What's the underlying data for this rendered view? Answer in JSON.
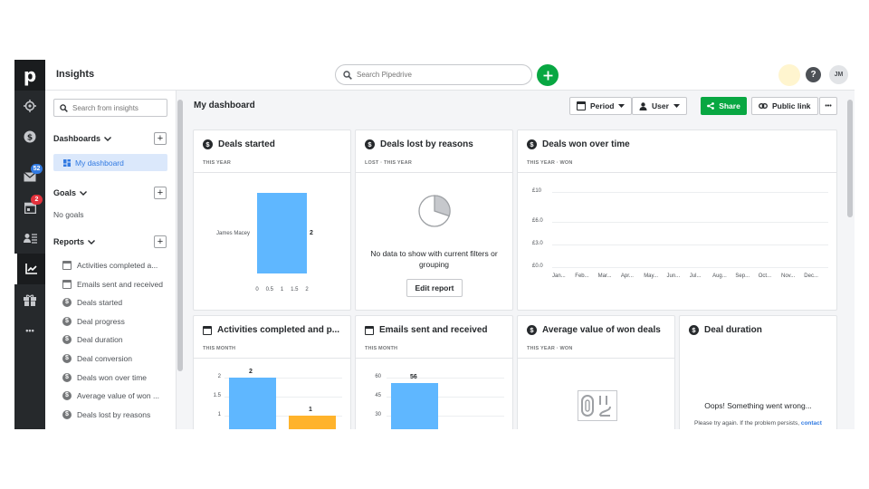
{
  "app": {
    "title": "Insights",
    "logo": "p"
  },
  "topbar": {
    "search_placeholder": "Search Pipedrive",
    "help": "?",
    "avatar": "JM"
  },
  "rail": {
    "mail_badge": "52",
    "calendar_badge": "2",
    "more": "•••",
    "badge_color": "#317ae2",
    "calendar_badge_color": "#e3313c"
  },
  "sidebar": {
    "search_placeholder": "Search from insights",
    "dashboards_label": "Dashboards",
    "active_dashboard": "My dashboard",
    "goals_label": "Goals",
    "no_goals": "No goals",
    "reports_label": "Reports",
    "reports": [
      {
        "label": "Activities completed a...",
        "icon": "calendar-icon"
      },
      {
        "label": "Emails sent and received",
        "icon": "calendar-icon"
      },
      {
        "label": "Deals started",
        "icon": "dollar-icon"
      },
      {
        "label": "Deal progress",
        "icon": "dollar-icon"
      },
      {
        "label": "Deal duration",
        "icon": "dollar-icon"
      },
      {
        "label": "Deal conversion",
        "icon": "dollar-icon"
      },
      {
        "label": "Deals won over time",
        "icon": "dollar-icon"
      },
      {
        "label": "Average value of won ...",
        "icon": "dollar-icon"
      },
      {
        "label": "Deals lost by reasons",
        "icon": "dollar-icon"
      }
    ]
  },
  "main": {
    "title": "My dashboard",
    "period_label": "Period",
    "user_label": "User",
    "share_label": "Share",
    "public_link_label": "Public link",
    "more": "•••"
  },
  "cards": {
    "deals_started": {
      "title": "Deals started",
      "subtitle": "THIS YEAR",
      "person": "James Macey",
      "value": 2,
      "value_label": "2",
      "xticks": [
        "0",
        "0.5",
        "1",
        "1.5",
        "2"
      ],
      "xmax": 2
    },
    "deals_lost": {
      "title": "Deals lost by reasons",
      "subtitle": "LOST  ·  THIS YEAR",
      "message": "No data to show with current filters or grouping",
      "edit_label": "Edit report"
    },
    "deals_won": {
      "title": "Deals won over time",
      "subtitle": "THIS YEAR  ·  WON",
      "yticks": [
        "£10",
        "£6.0",
        "£3.0",
        "£0.0"
      ],
      "months": [
        "Jan...",
        "Feb...",
        "Mar...",
        "Apr...",
        "May...",
        "Jun...",
        "Jul...",
        "Aug...",
        "Sep...",
        "Oct...",
        "Nov...",
        "Dec..."
      ]
    },
    "activities": {
      "title": "Activities completed and p...",
      "subtitle": "THIS MONTH",
      "yticks": [
        "2",
        "1.5",
        "1"
      ],
      "bars": [
        {
          "total": 2,
          "label": "2"
        },
        {
          "total": 1,
          "label": "1"
        }
      ],
      "color_primary": "#5fb7ff",
      "color_secondary": "#ffb32b"
    },
    "emails": {
      "title": "Emails sent and received",
      "subtitle": "THIS MONTH",
      "yticks": [
        "60",
        "45",
        "30"
      ],
      "value": 56,
      "value_label": "56",
      "color": "#5fb7ff"
    },
    "avg_value": {
      "title": "Average value of won deals",
      "subtitle": "THIS YEAR  ·  WON"
    },
    "deal_duration": {
      "title": "Deal duration",
      "error": "Oops! Something went wrong...",
      "error_detail": "Please try again. If the problem persists,",
      "contact": "contact"
    }
  },
  "chart_data": [
    {
      "type": "bar",
      "title": "Deals started",
      "categories": [
        "James Macey"
      ],
      "values": [
        2
      ],
      "xlim": [
        0,
        2
      ]
    },
    {
      "type": "bar",
      "title": "Activities completed and p...",
      "values": [
        2,
        1
      ]
    },
    {
      "type": "bar",
      "title": "Emails sent and received",
      "values": [
        56
      ]
    }
  ]
}
